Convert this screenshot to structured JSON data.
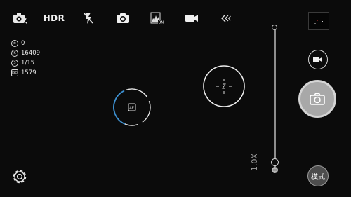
{
  "topbar": {
    "hdr_label": "HDR"
  },
  "info": {
    "rows": [
      {
        "icon": "ev-icon",
        "value": "0"
      },
      {
        "icon": "white-balance-icon",
        "value": "16409"
      },
      {
        "icon": "shutter-speed-icon",
        "value": "1/15"
      },
      {
        "icon": "iso-icon",
        "value": "1579"
      }
    ]
  },
  "zoom": {
    "label": "1.0X"
  },
  "controls": {
    "mode_label": "模式"
  },
  "colors": {
    "focus_ring_blue": "#3b8fd0",
    "thumbnail_accent": "#d22a2a"
  }
}
